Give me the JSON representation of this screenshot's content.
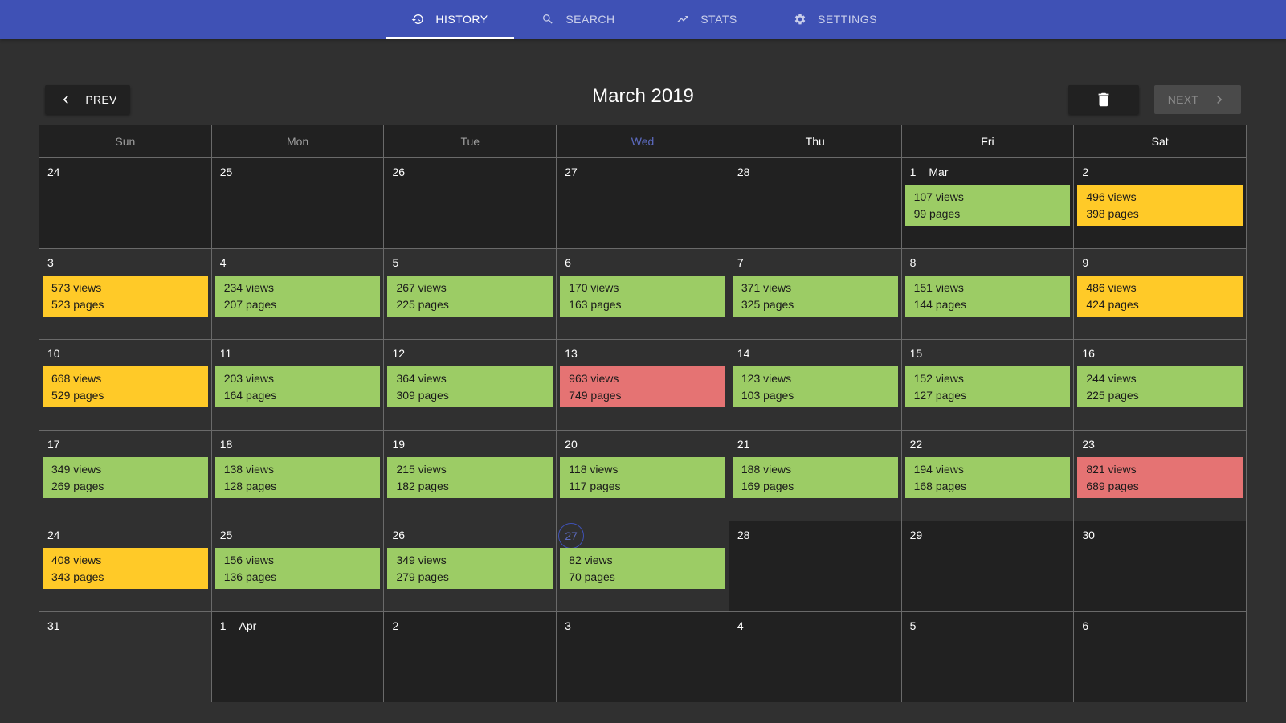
{
  "nav": {
    "tabs": [
      {
        "label": "HISTORY",
        "icon": "history-icon",
        "active": true
      },
      {
        "label": "SEARCH",
        "icon": "search-icon",
        "active": false
      },
      {
        "label": "STATS",
        "icon": "trending-up-icon",
        "active": false
      },
      {
        "label": "SETTINGS",
        "icon": "gear-icon",
        "active": false
      }
    ]
  },
  "header": {
    "month_title": "March 2019",
    "prev_label": "PREV",
    "next_label": "NEXT",
    "next_disabled": true,
    "delete_icon": "trash-icon"
  },
  "weekdays": [
    "Sun",
    "Mon",
    "Tue",
    "Wed",
    "Thu",
    "Fri",
    "Sat"
  ],
  "colors": {
    "primary": "#3f51b5",
    "low": "#9ccc65",
    "medium": "#ffca28",
    "high": "#e57373",
    "today_accent": "#5c6bc0"
  },
  "weeks": [
    [
      {
        "day": "24"
      },
      {
        "day": "25"
      },
      {
        "day": "26"
      },
      {
        "day": "27"
      },
      {
        "day": "28"
      },
      {
        "day": "1",
        "month": "Mar",
        "views": "107 views",
        "pages": "99 pages",
        "level": "low"
      },
      {
        "day": "2",
        "views": "496 views",
        "pages": "398 pages",
        "level": "medium"
      }
    ],
    [
      {
        "day": "3",
        "views": "573 views",
        "pages": "523 pages",
        "level": "medium"
      },
      {
        "day": "4",
        "views": "234 views",
        "pages": "207 pages",
        "level": "low"
      },
      {
        "day": "5",
        "views": "267 views",
        "pages": "225 pages",
        "level": "low"
      },
      {
        "day": "6",
        "views": "170 views",
        "pages": "163 pages",
        "level": "low"
      },
      {
        "day": "7",
        "views": "371 views",
        "pages": "325 pages",
        "level": "low"
      },
      {
        "day": "8",
        "views": "151 views",
        "pages": "144 pages",
        "level": "low"
      },
      {
        "day": "9",
        "views": "486 views",
        "pages": "424 pages",
        "level": "medium"
      }
    ],
    [
      {
        "day": "10",
        "views": "668 views",
        "pages": "529 pages",
        "level": "medium"
      },
      {
        "day": "11",
        "views": "203 views",
        "pages": "164 pages",
        "level": "low"
      },
      {
        "day": "12",
        "views": "364 views",
        "pages": "309 pages",
        "level": "low"
      },
      {
        "day": "13",
        "views": "963 views",
        "pages": "749 pages",
        "level": "high"
      },
      {
        "day": "14",
        "views": "123 views",
        "pages": "103 pages",
        "level": "low"
      },
      {
        "day": "15",
        "views": "152 views",
        "pages": "127 pages",
        "level": "low"
      },
      {
        "day": "16",
        "views": "244 views",
        "pages": "225 pages",
        "level": "low"
      }
    ],
    [
      {
        "day": "17",
        "views": "349 views",
        "pages": "269 pages",
        "level": "low"
      },
      {
        "day": "18",
        "views": "138 views",
        "pages": "128 pages",
        "level": "low"
      },
      {
        "day": "19",
        "views": "215 views",
        "pages": "182 pages",
        "level": "low"
      },
      {
        "day": "20",
        "views": "118 views",
        "pages": "117 pages",
        "level": "low"
      },
      {
        "day": "21",
        "views": "188 views",
        "pages": "169 pages",
        "level": "low"
      },
      {
        "day": "22",
        "views": "194 views",
        "pages": "168 pages",
        "level": "low"
      },
      {
        "day": "23",
        "views": "821 views",
        "pages": "689 pages",
        "level": "high"
      }
    ],
    [
      {
        "day": "24",
        "views": "408 views",
        "pages": "343 pages",
        "level": "medium"
      },
      {
        "day": "25",
        "views": "156 views",
        "pages": "136 pages",
        "level": "low"
      },
      {
        "day": "26",
        "views": "349 views",
        "pages": "279 pages",
        "level": "low"
      },
      {
        "day": "27",
        "views": "82 views",
        "pages": "70 pages",
        "level": "low",
        "today": true
      },
      {
        "day": "28"
      },
      {
        "day": "29"
      },
      {
        "day": "30"
      }
    ],
    [
      {
        "day": "31"
      },
      {
        "day": "1",
        "month": "Apr"
      },
      {
        "day": "2"
      },
      {
        "day": "3"
      },
      {
        "day": "4"
      },
      {
        "day": "5"
      },
      {
        "day": "6"
      }
    ]
  ]
}
